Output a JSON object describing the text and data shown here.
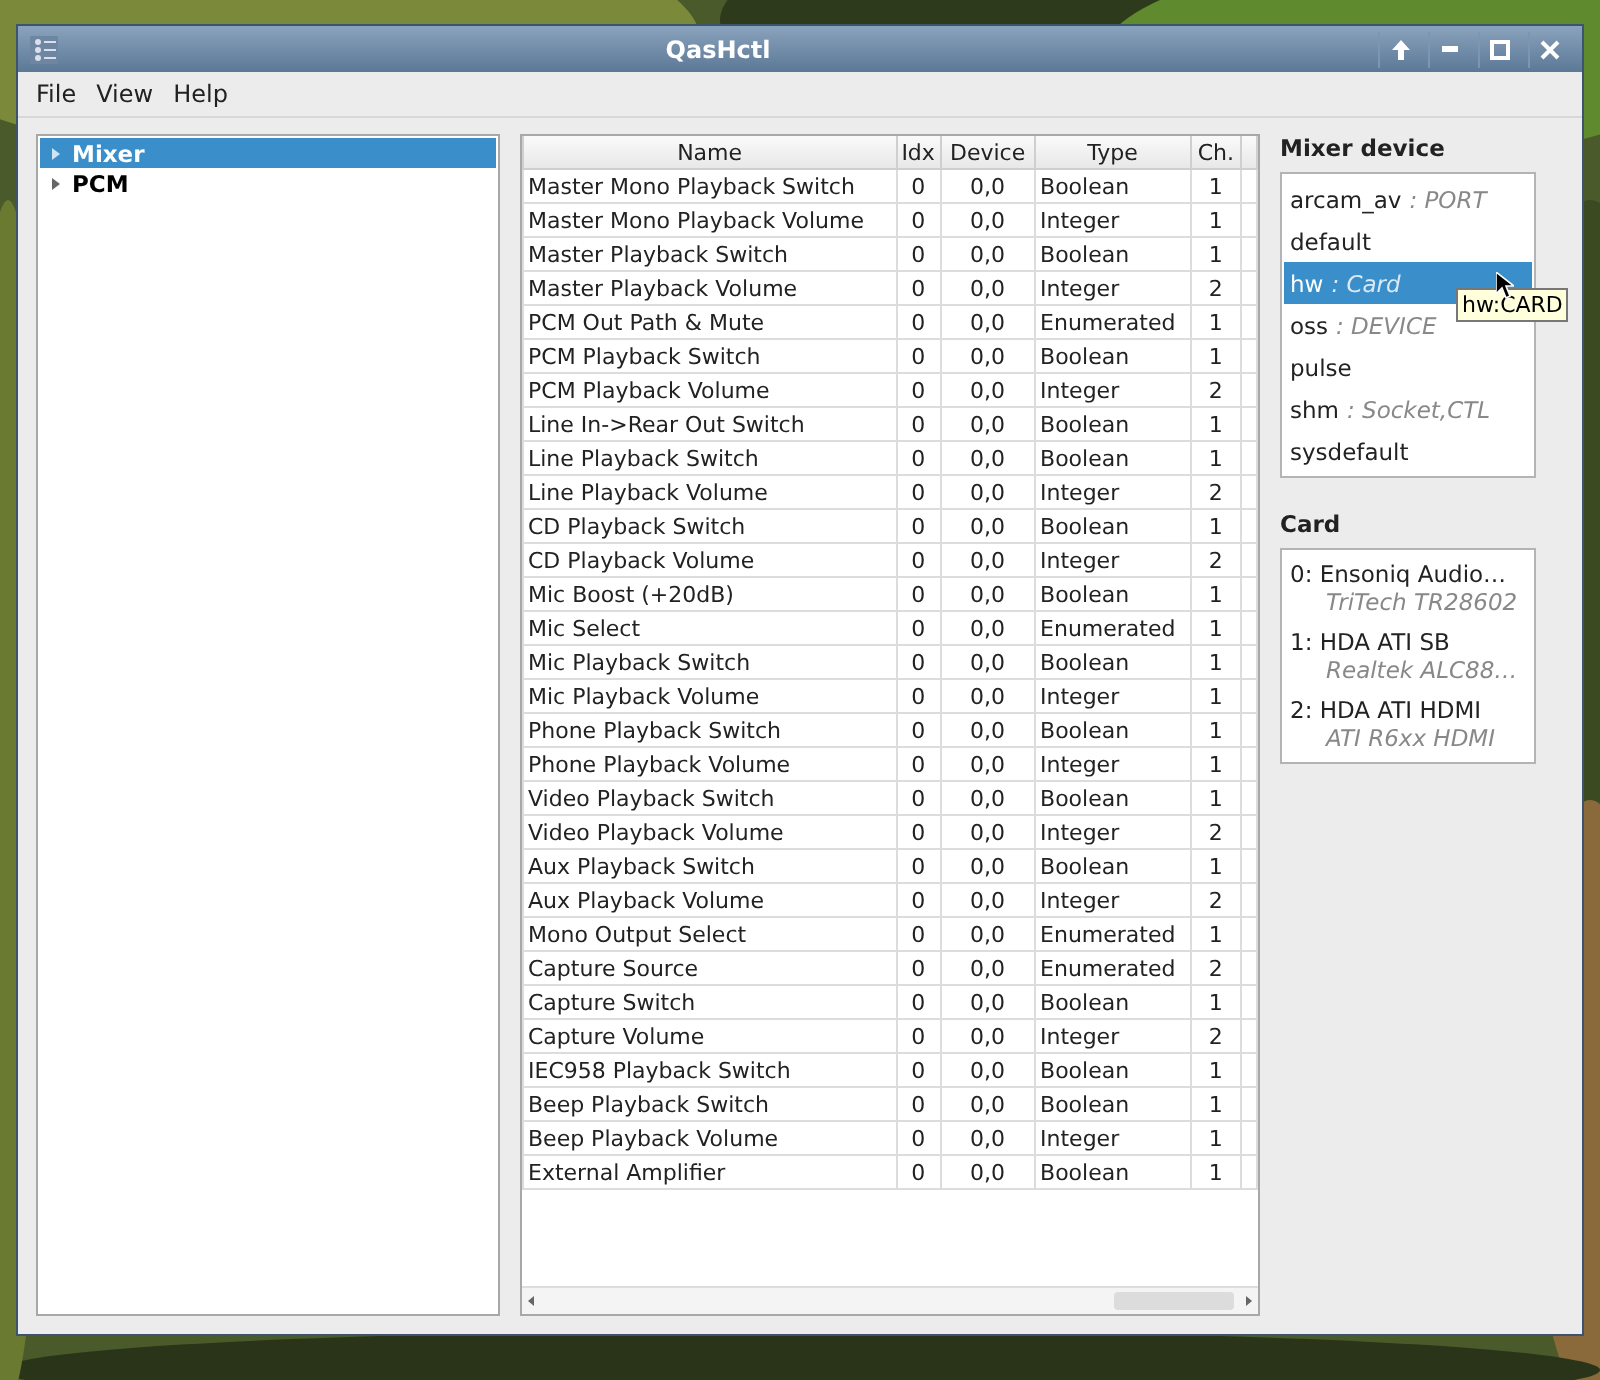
{
  "window": {
    "title": "QasHctl"
  },
  "title_buttons": [
    {
      "kind": "up"
    },
    {
      "kind": "minimize"
    },
    {
      "kind": "maximize"
    },
    {
      "kind": "close"
    }
  ],
  "menu": [
    "File",
    "View",
    "Help"
  ],
  "tree": [
    {
      "label": "Mixer",
      "selected": true
    },
    {
      "label": "PCM",
      "selected": false
    }
  ],
  "table": {
    "columns": [
      "Name",
      "Idx",
      "Device",
      "Type",
      "Ch."
    ],
    "rows": [
      [
        "Master Mono Playback Switch",
        "0",
        "0,0",
        "Boolean",
        "1"
      ],
      [
        "Master Mono Playback Volume",
        "0",
        "0,0",
        "Integer",
        "1"
      ],
      [
        "Master Playback Switch",
        "0",
        "0,0",
        "Boolean",
        "1"
      ],
      [
        "Master Playback Volume",
        "0",
        "0,0",
        "Integer",
        "2"
      ],
      [
        "PCM Out Path & Mute",
        "0",
        "0,0",
        "Enumerated",
        "1"
      ],
      [
        "PCM Playback Switch",
        "0",
        "0,0",
        "Boolean",
        "1"
      ],
      [
        "PCM Playback Volume",
        "0",
        "0,0",
        "Integer",
        "2"
      ],
      [
        "Line In->Rear Out Switch",
        "0",
        "0,0",
        "Boolean",
        "1"
      ],
      [
        "Line Playback Switch",
        "0",
        "0,0",
        "Boolean",
        "1"
      ],
      [
        "Line Playback Volume",
        "0",
        "0,0",
        "Integer",
        "2"
      ],
      [
        "CD Playback Switch",
        "0",
        "0,0",
        "Boolean",
        "1"
      ],
      [
        "CD Playback Volume",
        "0",
        "0,0",
        "Integer",
        "2"
      ],
      [
        "Mic Boost (+20dB)",
        "0",
        "0,0",
        "Boolean",
        "1"
      ],
      [
        "Mic Select",
        "0",
        "0,0",
        "Enumerated",
        "1"
      ],
      [
        "Mic Playback Switch",
        "0",
        "0,0",
        "Boolean",
        "1"
      ],
      [
        "Mic Playback Volume",
        "0",
        "0,0",
        "Integer",
        "1"
      ],
      [
        "Phone Playback Switch",
        "0",
        "0,0",
        "Boolean",
        "1"
      ],
      [
        "Phone Playback Volume",
        "0",
        "0,0",
        "Integer",
        "1"
      ],
      [
        "Video Playback Switch",
        "0",
        "0,0",
        "Boolean",
        "1"
      ],
      [
        "Video Playback Volume",
        "0",
        "0,0",
        "Integer",
        "2"
      ],
      [
        "Aux Playback Switch",
        "0",
        "0,0",
        "Boolean",
        "1"
      ],
      [
        "Aux Playback Volume",
        "0",
        "0,0",
        "Integer",
        "2"
      ],
      [
        "Mono Output Select",
        "0",
        "0,0",
        "Enumerated",
        "1"
      ],
      [
        "Capture Source",
        "0",
        "0,0",
        "Enumerated",
        "2"
      ],
      [
        "Capture Switch",
        "0",
        "0,0",
        "Boolean",
        "1"
      ],
      [
        "Capture Volume",
        "0",
        "0,0",
        "Integer",
        "2"
      ],
      [
        "IEC958 Playback Switch",
        "0",
        "0,0",
        "Boolean",
        "1"
      ],
      [
        "Beep Playback Switch",
        "0",
        "0,0",
        "Boolean",
        "1"
      ],
      [
        "Beep Playback Volume",
        "0",
        "0,0",
        "Integer",
        "1"
      ],
      [
        "External Amplifier",
        "0",
        "0,0",
        "Boolean",
        "1"
      ]
    ]
  },
  "mixer_device": {
    "label": "Mixer device",
    "items": [
      {
        "name": "arcam_av",
        "desc": ": PORT",
        "selected": false
      },
      {
        "name": "default",
        "selected": false
      },
      {
        "name": "hw",
        "desc": ": Card",
        "selected": true
      },
      {
        "name": "oss",
        "desc": ": DEVICE",
        "selected": false
      },
      {
        "name": "pulse",
        "selected": false
      },
      {
        "name": "shm",
        "desc": ": Socket,CTL",
        "selected": false
      },
      {
        "name": "sysdefault",
        "selected": false
      }
    ],
    "tooltip": "hw:CARD"
  },
  "card": {
    "label": "Card",
    "items": [
      {
        "name": "0: Ensoniq Audio…",
        "desc": "TriTech TR28602"
      },
      {
        "name": "1: HDA ATI SB",
        "desc": "Realtek ALC88…"
      },
      {
        "name": "2: HDA ATI HDMI",
        "desc": "ATI R6xx HDMI"
      }
    ]
  }
}
